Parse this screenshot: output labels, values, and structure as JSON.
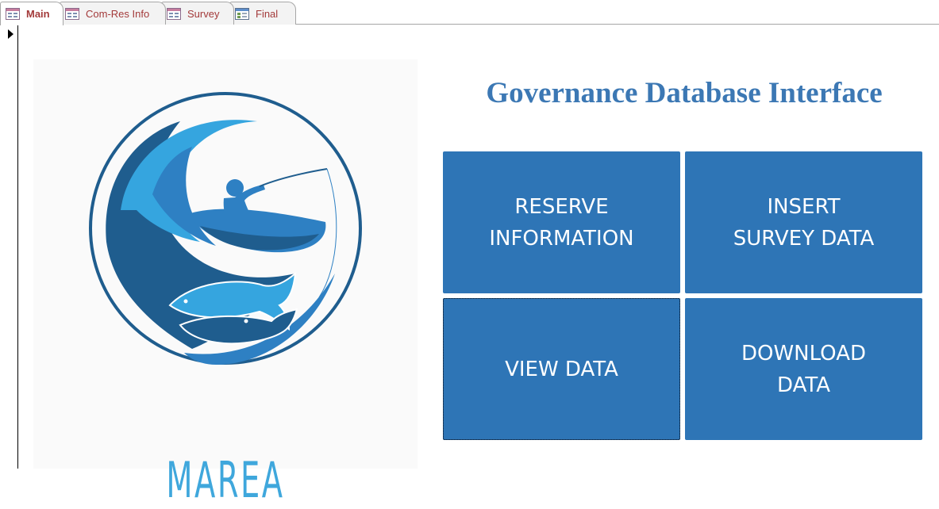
{
  "tabs": [
    {
      "label": "Main",
      "active": true
    },
    {
      "label": "Com-Res Info",
      "active": false
    },
    {
      "label": "Survey",
      "active": false
    },
    {
      "label": "Final",
      "active": false
    }
  ],
  "logo": {
    "wordmark": "MAREA",
    "colors": {
      "dark_blue": "#1f5d8e",
      "mid_blue": "#2e80c3",
      "light_blue": "#35a5df"
    }
  },
  "page": {
    "title": "Governance Database Interface"
  },
  "buttons": {
    "reserve_information": "RESERVE\nINFORMATION",
    "insert_survey_data": "INSERT\nSURVEY DATA",
    "view_data": "VIEW DATA",
    "download_data": "DOWNLOAD\nDATA"
  },
  "theme": {
    "button_color": "#2e75b6",
    "title_color": "#3c78b4",
    "tab_text_color": "#a33a3a"
  }
}
